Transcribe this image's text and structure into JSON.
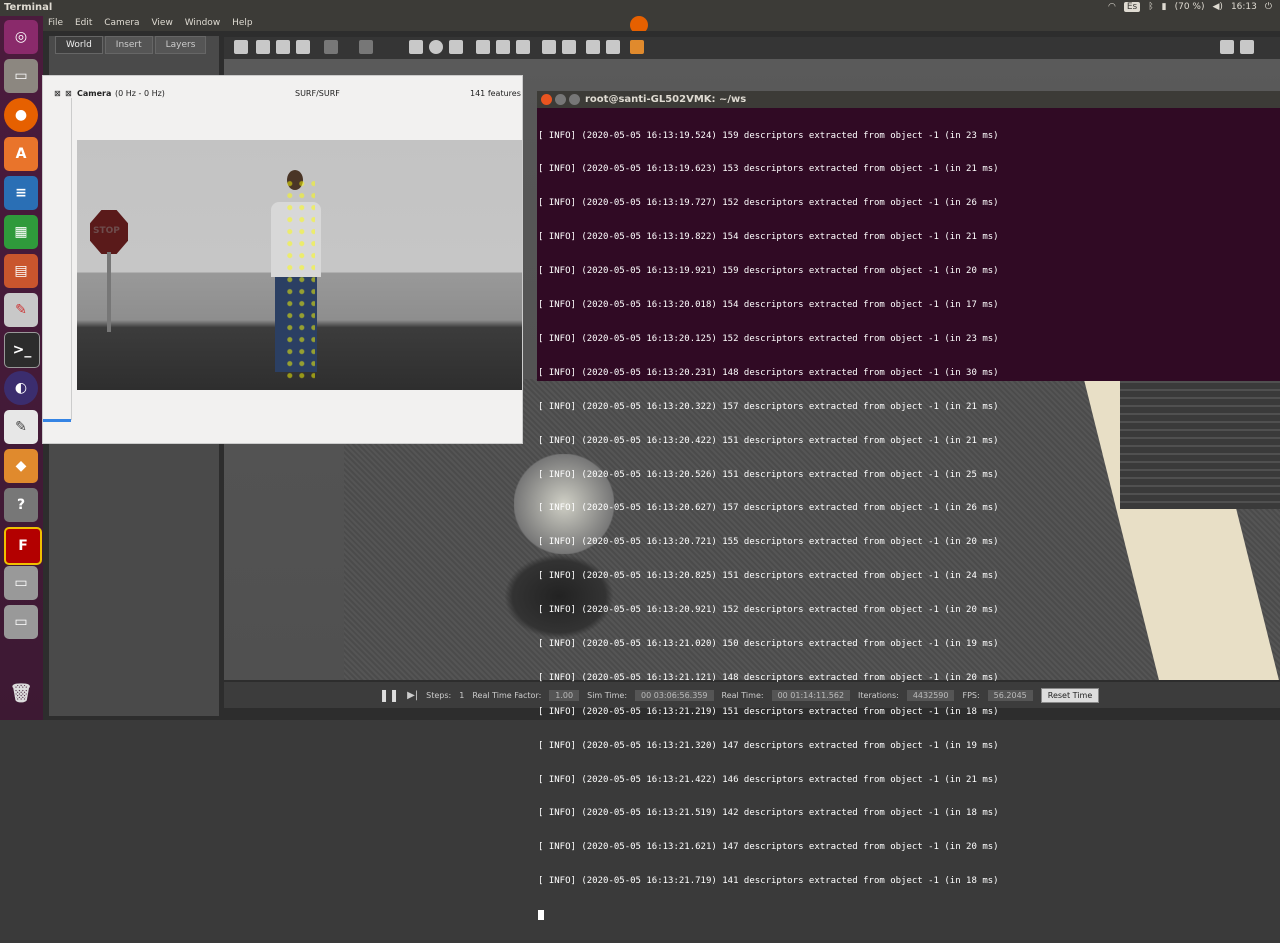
{
  "topbar": {
    "title": "Terminal",
    "keyboard": "Es",
    "battery": "(70 %)",
    "clock": "16:13"
  },
  "gazebo_menu": {
    "items": [
      "File",
      "Edit",
      "Camera",
      "View",
      "Window",
      "Help"
    ]
  },
  "gazebo_tabs": [
    "World",
    "Insert",
    "Layers"
  ],
  "gazebo_bottom": {
    "steps_label": "Steps:",
    "steps_value": "1",
    "rtf_label": "Real Time Factor:",
    "rtf_value": "1.00",
    "sim_label": "Sim Time:",
    "sim_value": "00 03:06:56.359",
    "real_label": "Real Time:",
    "real_value": "00 01:14:11.562",
    "iter_label": "Iterations:",
    "iter_value": "4432590",
    "fps_label": "FPS:",
    "fps_value": "56.2045",
    "reset": "Reset Time"
  },
  "camera_window": {
    "title": "Camera",
    "rate": "(0 Hz - 0 Hz)",
    "method": "SURF/SURF",
    "features": "141 features",
    "sign_text": "STOP"
  },
  "terminal": {
    "title": "root@santi-GL502VMK: ~/ws",
    "lines": [
      "[ INFO] (2020-05-05 16:13:19.524) 159 descriptors extracted from object -1 (in 23 ms)",
      "[ INFO] (2020-05-05 16:13:19.623) 153 descriptors extracted from object -1 (in 21 ms)",
      "[ INFO] (2020-05-05 16:13:19.727) 152 descriptors extracted from object -1 (in 26 ms)",
      "[ INFO] (2020-05-05 16:13:19.822) 154 descriptors extracted from object -1 (in 21 ms)",
      "[ INFO] (2020-05-05 16:13:19.921) 159 descriptors extracted from object -1 (in 20 ms)",
      "[ INFO] (2020-05-05 16:13:20.018) 154 descriptors extracted from object -1 (in 17 ms)",
      "[ INFO] (2020-05-05 16:13:20.125) 152 descriptors extracted from object -1 (in 23 ms)",
      "[ INFO] (2020-05-05 16:13:20.231) 148 descriptors extracted from object -1 (in 30 ms)",
      "[ INFO] (2020-05-05 16:13:20.322) 157 descriptors extracted from object -1 (in 21 ms)",
      "[ INFO] (2020-05-05 16:13:20.422) 151 descriptors extracted from object -1 (in 21 ms)",
      "[ INFO] (2020-05-05 16:13:20.526) 151 descriptors extracted from object -1 (in 25 ms)",
      "[ INFO] (2020-05-05 16:13:20.627) 157 descriptors extracted from object -1 (in 26 ms)",
      "[ INFO] (2020-05-05 16:13:20.721) 155 descriptors extracted from object -1 (in 20 ms)",
      "[ INFO] (2020-05-05 16:13:20.825) 151 descriptors extracted from object -1 (in 24 ms)",
      "[ INFO] (2020-05-05 16:13:20.921) 152 descriptors extracted from object -1 (in 20 ms)",
      "[ INFO] (2020-05-05 16:13:21.020) 150 descriptors extracted from object -1 (in 19 ms)",
      "[ INFO] (2020-05-05 16:13:21.121) 148 descriptors extracted from object -1 (in 20 ms)",
      "[ INFO] (2020-05-05 16:13:21.219) 151 descriptors extracted from object -1 (in 18 ms)",
      "[ INFO] (2020-05-05 16:13:21.320) 147 descriptors extracted from object -1 (in 19 ms)",
      "[ INFO] (2020-05-05 16:13:21.422) 146 descriptors extracted from object -1 (in 21 ms)",
      "[ INFO] (2020-05-05 16:13:21.519) 142 descriptors extracted from object -1 (in 18 ms)",
      "[ INFO] (2020-05-05 16:13:21.621) 147 descriptors extracted from object -1 (in 20 ms)",
      "[ INFO] (2020-05-05 16:13:21.719) 141 descriptors extracted from object -1 (in 18 ms)"
    ]
  },
  "launcher_icons": [
    "ubuntu-icon",
    "files-icon",
    "firefox-icon",
    "software-center-icon",
    "writer-icon",
    "calc-icon",
    "impress-icon",
    "settings-icon",
    "terminal-icon",
    "eclipse-icon",
    "text-editor-icon",
    "virtualbox-icon",
    "help-icon",
    "filezilla-icon",
    "drive-icon",
    "drive-icon",
    "trash-icon"
  ]
}
